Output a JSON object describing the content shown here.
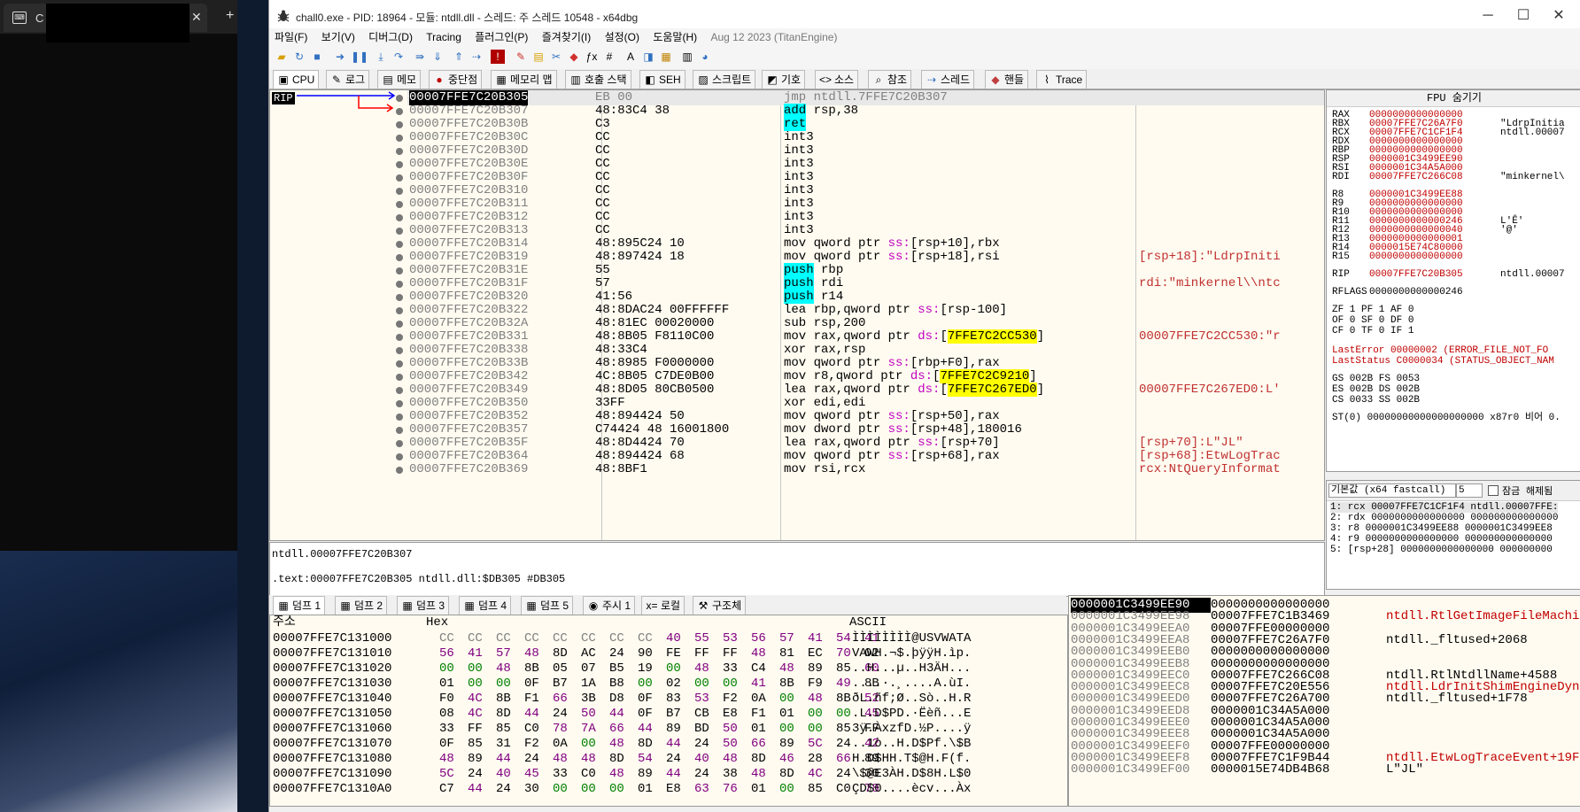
{
  "bg": {
    "tab_title": "C",
    "icon": "terminal-icon"
  },
  "window": {
    "title": "chall0.exe - PID: 18964 - 모듈: ntdll.dll - 스레드: 주 스레드 10548 - x64dbg",
    "min": "─",
    "max": "☐",
    "close": "✕"
  },
  "menu": [
    "파일(F)",
    "보기(V)",
    "디버그(D)",
    "Tracing",
    "플러그인(P)",
    "즐겨찾기(I)",
    "설정(O)",
    "도움말(H)"
  ],
  "menu_version": "Aug 12 2023 (TitanEngine)",
  "tabs": [
    {
      "label": "CPU",
      "icon": "▣"
    },
    {
      "label": "로그",
      "icon": "✎"
    },
    {
      "label": "메모",
      "icon": "▤"
    },
    {
      "label": "중단점",
      "icon": "●"
    },
    {
      "label": "메모리 맵",
      "icon": "▦"
    },
    {
      "label": "호출 스택",
      "icon": "▥"
    },
    {
      "label": "SEH",
      "icon": "◧"
    },
    {
      "label": "스크립트",
      "icon": "▨"
    },
    {
      "label": "기호",
      "icon": "◩"
    },
    {
      "label": "소스",
      "icon": "<>"
    },
    {
      "label": "참조",
      "icon": "⌕"
    },
    {
      "label": "스레드",
      "icon": "⇢"
    },
    {
      "label": "핸들",
      "icon": "◆"
    },
    {
      "label": "Trace",
      "icon": "⌇"
    }
  ],
  "rip_label": "RIP",
  "disasm": [
    {
      "a": "00007FFE7C20B305",
      "b": "EB 00",
      "i": "jmp ntdll.7FFE7C20B307",
      "c": ""
    },
    {
      "a": "00007FFE7C20B307",
      "b": "48:83C4 38",
      "i": "add rsp,38",
      "c": ""
    },
    {
      "a": "00007FFE7C20B30B",
      "b": "C3",
      "i": "ret",
      "c": ""
    },
    {
      "a": "00007FFE7C20B30C",
      "b": "CC",
      "i": "int3",
      "c": ""
    },
    {
      "a": "00007FFE7C20B30D",
      "b": "CC",
      "i": "int3",
      "c": ""
    },
    {
      "a": "00007FFE7C20B30E",
      "b": "CC",
      "i": "int3",
      "c": ""
    },
    {
      "a": "00007FFE7C20B30F",
      "b": "CC",
      "i": "int3",
      "c": ""
    },
    {
      "a": "00007FFE7C20B310",
      "b": "CC",
      "i": "int3",
      "c": ""
    },
    {
      "a": "00007FFE7C20B311",
      "b": "CC",
      "i": "int3",
      "c": ""
    },
    {
      "a": "00007FFE7C20B312",
      "b": "CC",
      "i": "int3",
      "c": ""
    },
    {
      "a": "00007FFE7C20B313",
      "b": "CC",
      "i": "int3",
      "c": ""
    },
    {
      "a": "00007FFE7C20B314",
      "b": "48:895C24 10",
      "i": "mov qword ptr ss:[rsp+10],rbx",
      "c": ""
    },
    {
      "a": "00007FFE7C20B319",
      "b": "48:897424 18",
      "i": "mov qword ptr ss:[rsp+18],rsi",
      "c": "[rsp+18]:\"LdrpIniti"
    },
    {
      "a": "00007FFE7C20B31E",
      "b": "55",
      "i": "push rbp",
      "c": ""
    },
    {
      "a": "00007FFE7C20B31F",
      "b": "57",
      "i": "push rdi",
      "c": "rdi:\"minkernel\\\\ntc"
    },
    {
      "a": "00007FFE7C20B320",
      "b": "41:56",
      "i": "push r14",
      "c": ""
    },
    {
      "a": "00007FFE7C20B322",
      "b": "48:8DAC24 00FFFFFF",
      "i": "lea rbp,qword ptr ss:[rsp-100]",
      "c": ""
    },
    {
      "a": "00007FFE7C20B32A",
      "b": "48:81EC 00020000",
      "i": "sub rsp,200",
      "c": ""
    },
    {
      "a": "00007FFE7C20B331",
      "b": "48:8B05 F8110C00",
      "i": "mov rax,qword ptr ds:[7FFE7C2CC530]",
      "c": "00007FFE7C2CC530:\"r"
    },
    {
      "a": "00007FFE7C20B338",
      "b": "48:33C4",
      "i": "xor rax,rsp",
      "c": ""
    },
    {
      "a": "00007FFE7C20B33B",
      "b": "48:8985 F0000000",
      "i": "mov qword ptr ss:[rbp+F0],rax",
      "c": ""
    },
    {
      "a": "00007FFE7C20B342",
      "b": "4C:8B05 C7DE0B00",
      "i": "mov r8,qword ptr ds:[7FFE7C2C9210]",
      "c": ""
    },
    {
      "a": "00007FFE7C20B349",
      "b": "48:8D05 80CB0500",
      "i": "lea rax,qword ptr ds:[7FFE7C267ED0]",
      "c": "00007FFE7C267ED0:L'"
    },
    {
      "a": "00007FFE7C20B350",
      "b": "33FF",
      "i": "xor edi,edi",
      "c": ""
    },
    {
      "a": "00007FFE7C20B352",
      "b": "48:894424 50",
      "i": "mov qword ptr ss:[rsp+50],rax",
      "c": ""
    },
    {
      "a": "00007FFE7C20B357",
      "b": "C74424 48 16001800",
      "i": "mov dword ptr ss:[rsp+48],180016",
      "c": ""
    },
    {
      "a": "00007FFE7C20B35F",
      "b": "48:8D4424 70",
      "i": "lea rax,qword ptr ss:[rsp+70]",
      "c": "[rsp+70]:L\"JL\""
    },
    {
      "a": "00007FFE7C20B364",
      "b": "48:894424 68",
      "i": "mov qword ptr ss:[rsp+68],rax",
      "c": "[rsp+68]:EtwLogTrac"
    },
    {
      "a": "00007FFE7C20B369",
      "b": "48:8BF1",
      "i": "mov rsi,rcx",
      "c": "rcx:NtQueryInformat"
    }
  ],
  "info_lines": [
    "ntdll.00007FFE7C20B307",
    ".text:00007FFE7C20B305 ntdll.dll:$DB305 #DB305"
  ],
  "regs_header": "FPU 숨기기",
  "regs": [
    {
      "n": "RAX",
      "v": "0000000000000000",
      "s": ""
    },
    {
      "n": "RBX",
      "v": "00007FFE7C26A7F0",
      "s": "\"LdrpInitia"
    },
    {
      "n": "RCX",
      "v": "00007FFE7C1CF1F4",
      "s": "ntdll.00007"
    },
    {
      "n": "RDX",
      "v": "0000000000000000",
      "s": ""
    },
    {
      "n": "RBP",
      "v": "0000000000000000",
      "s": ""
    },
    {
      "n": "RSP",
      "v": "0000001C3499EE90",
      "s": ""
    },
    {
      "n": "RSI",
      "v": "0000001C34A5A000",
      "s": ""
    },
    {
      "n": "RDI",
      "v": "00007FFE7C266C08",
      "s": "\"minkernel\\"
    },
    {
      "n": "R8",
      "v": "0000001C3499EE88",
      "s": ""
    },
    {
      "n": "R9",
      "v": "0000000000000000",
      "s": ""
    },
    {
      "n": "R10",
      "v": "0000000000000000",
      "s": ""
    },
    {
      "n": "R11",
      "v": "0000000000000246",
      "s": "L'Ȇ'"
    },
    {
      "n": "R12",
      "v": "0000000000000040",
      "s": "'@'"
    },
    {
      "n": "R13",
      "v": "0000000000000001",
      "s": ""
    },
    {
      "n": "R14",
      "v": "0000015E74C80000",
      "s": ""
    },
    {
      "n": "R15",
      "v": "0000000000000000",
      "s": ""
    },
    {
      "n": "RIP",
      "v": "00007FFE7C20B305",
      "s": "ntdll.00007"
    },
    {
      "n": "RFLAGS",
      "v": "0000000000000246",
      "s": ""
    }
  ],
  "flags": [
    "ZF 1  PF 1  AF 0",
    "OF 0  SF 0  DF 0",
    "CF 0  TF 0  IF 1"
  ],
  "last_error": "LastError  00000002 (ERROR_FILE_NOT_FO",
  "last_status": "LastStatus C0000034 (STATUS_OBJECT_NAM",
  "segs": [
    "GS 002B  FS 0053",
    "ES 002B  DS 002B",
    "CS 0033  SS 002B"
  ],
  "st0": "ST(0) 00000000000000000000 x87r0 비어 0.",
  "callconv": {
    "select": "기본값 (x64 fastcall)",
    "count": "5",
    "lock": "잠금 해제됨",
    "rows": [
      "1: rcx 00007FFE7C1CF1F4 ntdll.00007FFE:",
      "2: rdx 0000000000000000 000000000000000",
      "3: r8 0000001C3499EE88 0000001C3499EE8",
      "4: r9 0000000000000000 000000000000000",
      "5: [rsp+28] 0000000000000000 000000000"
    ]
  },
  "dump_tabs": [
    {
      "label": "덤프 1",
      "icon": "▦"
    },
    {
      "label": "덤프 2",
      "icon": "▦"
    },
    {
      "label": "덤프 3",
      "icon": "▦"
    },
    {
      "label": "덤프 4",
      "icon": "▦"
    },
    {
      "label": "덤프 5",
      "icon": "▦"
    },
    {
      "label": "주시 1",
      "icon": "◉"
    },
    {
      "label": "로컬",
      "icon": "x="
    },
    {
      "label": "구조체",
      "icon": "⚒"
    }
  ],
  "dump_headers": {
    "addr": "주소",
    "hex": "Hex",
    "ascii": "ASCII"
  },
  "dump": [
    {
      "a": "00007FFE7C131000",
      "h": [
        "CC",
        "CC",
        "CC",
        "CC",
        "CC",
        "CC",
        "CC",
        "CC",
        "40",
        "55",
        "53",
        "56",
        "57",
        "41",
        "54",
        "41"
      ],
      "s": "ÌÌÌÌÌÌÌÌ@USVWATA"
    },
    {
      "a": "00007FFE7C131010",
      "h": [
        "56",
        "41",
        "57",
        "48",
        "8D",
        "AC",
        "24",
        "90",
        "FE",
        "FF",
        "FF",
        "48",
        "81",
        "EC",
        "70",
        "02"
      ],
      "s": "VAWH.¬$.þÿÿH.ìp."
    },
    {
      "a": "00007FFE7C131020",
      "h": [
        "00",
        "00",
        "48",
        "8B",
        "05",
        "07",
        "B5",
        "19",
        "00",
        "48",
        "33",
        "C4",
        "48",
        "89",
        "85",
        "60"
      ],
      "s": "..H...µ..H3ÄH..."
    },
    {
      "a": "00007FFE7C131030",
      "h": [
        "01",
        "00",
        "00",
        "0F",
        "B7",
        "1A",
        "B8",
        "00",
        "02",
        "00",
        "00",
        "41",
        "8B",
        "F9",
        "49",
        "8B"
      ],
      "s": "....·.¸....A.ùI."
    },
    {
      "a": "00007FFE7C131040",
      "h": [
        "F0",
        "4C",
        "8B",
        "F1",
        "66",
        "3B",
        "D8",
        "0F",
        "83",
        "53",
        "F2",
        "0A",
        "00",
        "48",
        "8B",
        "52"
      ],
      "s": "ðL.ñf;Ø..Sò..H.R"
    },
    {
      "a": "00007FFE7C131050",
      "h": [
        "08",
        "4C",
        "8D",
        "44",
        "24",
        "50",
        "44",
        "0F",
        "B7",
        "CB",
        "E8",
        "F1",
        "01",
        "00",
        "00",
        "45"
      ],
      "s": ".L.D$PD.·Ëèñ...E"
    },
    {
      "a": "00007FFE7C131060",
      "h": [
        "33",
        "FF",
        "85",
        "C0",
        "78",
        "7A",
        "66",
        "44",
        "89",
        "BD",
        "50",
        "01",
        "00",
        "00",
        "85",
        "FF"
      ],
      "s": "3ÿ.ÀxzfD.½P....ÿ"
    },
    {
      "a": "00007FFE7C131070",
      "h": [
        "0F",
        "85",
        "31",
        "F2",
        "0A",
        "00",
        "48",
        "8D",
        "44",
        "24",
        "50",
        "66",
        "89",
        "5C",
        "24",
        "42"
      ],
      "s": "..1ò..H.D$Pf.\\$B"
    },
    {
      "a": "00007FFE7C131080",
      "h": [
        "48",
        "89",
        "44",
        "24",
        "48",
        "48",
        "8D",
        "54",
        "24",
        "40",
        "48",
        "8D",
        "46",
        "28",
        "66",
        "89"
      ],
      "s": "H.D$HH.T$@H.F(f."
    },
    {
      "a": "00007FFE7C131090",
      "h": [
        "5C",
        "24",
        "40",
        "45",
        "33",
        "C0",
        "48",
        "89",
        "44",
        "24",
        "38",
        "48",
        "8D",
        "4C",
        "24",
        "30"
      ],
      "s": "\\$@E3ÀH.D$8H.L$0"
    },
    {
      "a": "00007FFE7C1310A0",
      "h": [
        "C7",
        "44",
        "24",
        "30",
        "00",
        "00",
        "00",
        "01",
        "E8",
        "63",
        "76",
        "01",
        "00",
        "85",
        "C0",
        "78"
      ],
      "s": "ÇD$0....ècv...Àx"
    }
  ],
  "stack": [
    {
      "a": "0000001C3499EE90",
      "v": "0000000000000000",
      "c": "",
      "red": false
    },
    {
      "a": "0000001C3499EE98",
      "v": "00007FFE7C1B3469",
      "c": "ntdll.RtlGetImageFileMachine",
      "red": true
    },
    {
      "a": "0000001C3499EEA0",
      "v": "00007FFE00000000",
      "c": "",
      "red": false
    },
    {
      "a": "0000001C3499EEA8",
      "v": "00007FFE7C26A7F0",
      "c": "ntdll._fltused+2068",
      "red": false
    },
    {
      "a": "0000001C3499EEB0",
      "v": "0000000000000000",
      "c": "",
      "red": false
    },
    {
      "a": "0000001C3499EEB8",
      "v": "0000000000000000",
      "c": "",
      "red": false
    },
    {
      "a": "0000001C3499EEC0",
      "v": "00007FFE7C266C08",
      "c": "ntdll.RtlNtdllName+4588",
      "red": false
    },
    {
      "a": "0000001C3499EEC8",
      "v": "00007FFE7C20E556",
      "c": "ntdll.LdrInitShimEngineDynam",
      "red": true
    },
    {
      "a": "0000001C3499EED0",
      "v": "00007FFE7C26A700",
      "c": "ntdll._fltused+1F78",
      "red": false
    },
    {
      "a": "0000001C3499EED8",
      "v": "0000001C34A5A000",
      "c": "",
      "red": false
    },
    {
      "a": "0000001C3499EEE0",
      "v": "0000001C34A5A000",
      "c": "",
      "red": false
    },
    {
      "a": "0000001C3499EEE8",
      "v": "0000001C34A5A000",
      "c": "",
      "red": false
    },
    {
      "a": "0000001C3499EEF0",
      "v": "00007FFE00000000",
      "c": "",
      "red": false
    },
    {
      "a": "0000001C3499EEF8",
      "v": "00007FFE7C1F9B44",
      "c": "ntdll.EtwLogTraceEvent+19F74",
      "red": true
    },
    {
      "a": "0000001C3499EF00",
      "v": "0000015E74DB4B68",
      "c": "L\"JL\"",
      "red": false
    }
  ]
}
